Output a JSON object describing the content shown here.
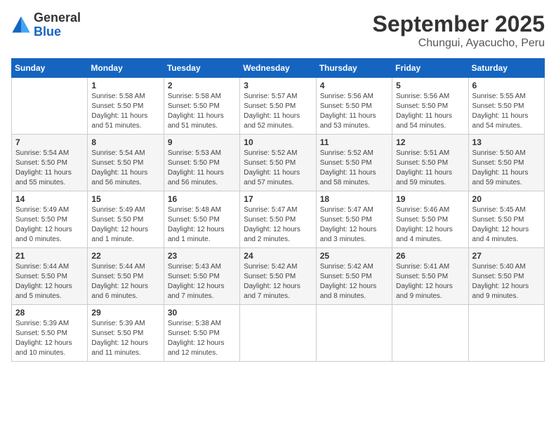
{
  "logo": {
    "general": "General",
    "blue": "Blue"
  },
  "title": "September 2025",
  "location": "Chungui, Ayacucho, Peru",
  "days_of_week": [
    "Sunday",
    "Monday",
    "Tuesday",
    "Wednesday",
    "Thursday",
    "Friday",
    "Saturday"
  ],
  "weeks": [
    [
      {
        "day": "",
        "info": ""
      },
      {
        "day": "1",
        "info": "Sunrise: 5:58 AM\nSunset: 5:50 PM\nDaylight: 11 hours\nand 51 minutes."
      },
      {
        "day": "2",
        "info": "Sunrise: 5:58 AM\nSunset: 5:50 PM\nDaylight: 11 hours\nand 51 minutes."
      },
      {
        "day": "3",
        "info": "Sunrise: 5:57 AM\nSunset: 5:50 PM\nDaylight: 11 hours\nand 52 minutes."
      },
      {
        "day": "4",
        "info": "Sunrise: 5:56 AM\nSunset: 5:50 PM\nDaylight: 11 hours\nand 53 minutes."
      },
      {
        "day": "5",
        "info": "Sunrise: 5:56 AM\nSunset: 5:50 PM\nDaylight: 11 hours\nand 54 minutes."
      },
      {
        "day": "6",
        "info": "Sunrise: 5:55 AM\nSunset: 5:50 PM\nDaylight: 11 hours\nand 54 minutes."
      }
    ],
    [
      {
        "day": "7",
        "info": "Sunrise: 5:54 AM\nSunset: 5:50 PM\nDaylight: 11 hours\nand 55 minutes."
      },
      {
        "day": "8",
        "info": "Sunrise: 5:54 AM\nSunset: 5:50 PM\nDaylight: 11 hours\nand 56 minutes."
      },
      {
        "day": "9",
        "info": "Sunrise: 5:53 AM\nSunset: 5:50 PM\nDaylight: 11 hours\nand 56 minutes."
      },
      {
        "day": "10",
        "info": "Sunrise: 5:52 AM\nSunset: 5:50 PM\nDaylight: 11 hours\nand 57 minutes."
      },
      {
        "day": "11",
        "info": "Sunrise: 5:52 AM\nSunset: 5:50 PM\nDaylight: 11 hours\nand 58 minutes."
      },
      {
        "day": "12",
        "info": "Sunrise: 5:51 AM\nSunset: 5:50 PM\nDaylight: 11 hours\nand 59 minutes."
      },
      {
        "day": "13",
        "info": "Sunrise: 5:50 AM\nSunset: 5:50 PM\nDaylight: 11 hours\nand 59 minutes."
      }
    ],
    [
      {
        "day": "14",
        "info": "Sunrise: 5:49 AM\nSunset: 5:50 PM\nDaylight: 12 hours\nand 0 minutes."
      },
      {
        "day": "15",
        "info": "Sunrise: 5:49 AM\nSunset: 5:50 PM\nDaylight: 12 hours\nand 1 minute."
      },
      {
        "day": "16",
        "info": "Sunrise: 5:48 AM\nSunset: 5:50 PM\nDaylight: 12 hours\nand 1 minute."
      },
      {
        "day": "17",
        "info": "Sunrise: 5:47 AM\nSunset: 5:50 PM\nDaylight: 12 hours\nand 2 minutes."
      },
      {
        "day": "18",
        "info": "Sunrise: 5:47 AM\nSunset: 5:50 PM\nDaylight: 12 hours\nand 3 minutes."
      },
      {
        "day": "19",
        "info": "Sunrise: 5:46 AM\nSunset: 5:50 PM\nDaylight: 12 hours\nand 4 minutes."
      },
      {
        "day": "20",
        "info": "Sunrise: 5:45 AM\nSunset: 5:50 PM\nDaylight: 12 hours\nand 4 minutes."
      }
    ],
    [
      {
        "day": "21",
        "info": "Sunrise: 5:44 AM\nSunset: 5:50 PM\nDaylight: 12 hours\nand 5 minutes."
      },
      {
        "day": "22",
        "info": "Sunrise: 5:44 AM\nSunset: 5:50 PM\nDaylight: 12 hours\nand 6 minutes."
      },
      {
        "day": "23",
        "info": "Sunrise: 5:43 AM\nSunset: 5:50 PM\nDaylight: 12 hours\nand 7 minutes."
      },
      {
        "day": "24",
        "info": "Sunrise: 5:42 AM\nSunset: 5:50 PM\nDaylight: 12 hours\nand 7 minutes."
      },
      {
        "day": "25",
        "info": "Sunrise: 5:42 AM\nSunset: 5:50 PM\nDaylight: 12 hours\nand 8 minutes."
      },
      {
        "day": "26",
        "info": "Sunrise: 5:41 AM\nSunset: 5:50 PM\nDaylight: 12 hours\nand 9 minutes."
      },
      {
        "day": "27",
        "info": "Sunrise: 5:40 AM\nSunset: 5:50 PM\nDaylight: 12 hours\nand 9 minutes."
      }
    ],
    [
      {
        "day": "28",
        "info": "Sunrise: 5:39 AM\nSunset: 5:50 PM\nDaylight: 12 hours\nand 10 minutes."
      },
      {
        "day": "29",
        "info": "Sunrise: 5:39 AM\nSunset: 5:50 PM\nDaylight: 12 hours\nand 11 minutes."
      },
      {
        "day": "30",
        "info": "Sunrise: 5:38 AM\nSunset: 5:50 PM\nDaylight: 12 hours\nand 12 minutes."
      },
      {
        "day": "",
        "info": ""
      },
      {
        "day": "",
        "info": ""
      },
      {
        "day": "",
        "info": ""
      },
      {
        "day": "",
        "info": ""
      }
    ]
  ]
}
